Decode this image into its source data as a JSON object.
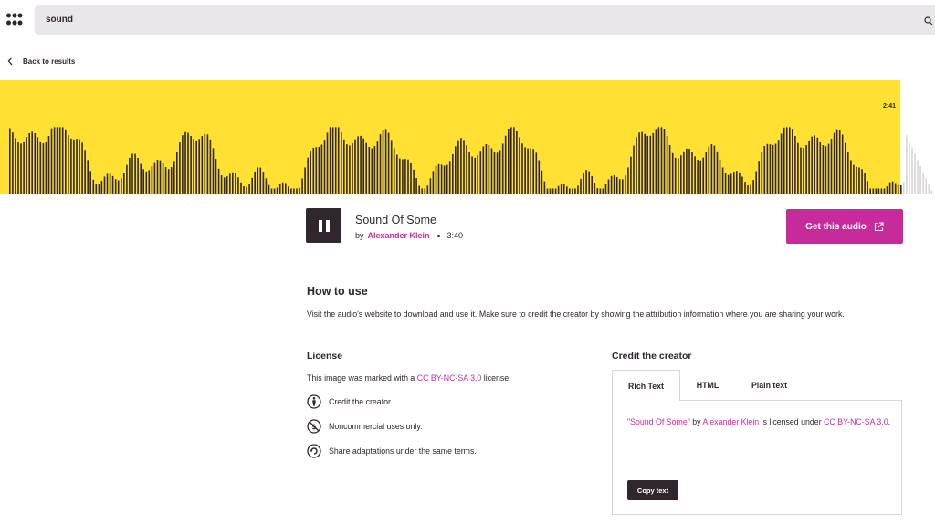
{
  "header": {
    "search_value": "sound"
  },
  "nav": {
    "back_label": "Back to results"
  },
  "player": {
    "time_marker": "2:41",
    "played_fraction": 0.963,
    "title": "Sound Of Some",
    "by": "by",
    "creator": "Alexander Klein",
    "duration": "3:40",
    "get_button": "Get this audio",
    "colors": {
      "waveform_bg": "#ffe033",
      "bar_played": "#30272e",
      "bar_unplayed": "#d8d4d8"
    }
  },
  "how_to_use": {
    "heading": "How to use",
    "text": "Visit the audio's website to download and use it. Make sure to credit the creator by showing the attribution information where you are sharing your work."
  },
  "license": {
    "heading": "License",
    "intro_before": "This image was marked with a ",
    "license_name": "CC BY-NC-SA 3.0",
    "intro_after": " license:",
    "items": [
      {
        "icon": "cc-by-icon",
        "text": "Credit the creator."
      },
      {
        "icon": "cc-nc-icon",
        "text": "Noncommercial uses only."
      },
      {
        "icon": "cc-sa-icon",
        "text": "Share adaptations under the same terms."
      }
    ]
  },
  "credit": {
    "heading": "Credit the creator",
    "tabs": [
      "Rich Text",
      "HTML",
      "Plain text"
    ],
    "active_tab": "Rich Text",
    "text_title": "\"Sound Of Some\"",
    "text_by": " by ",
    "text_creator": "Alexander Klein",
    "text_licensed": " is licensed under ",
    "text_license": "CC BY-NC-SA 3.0",
    "text_end": ".",
    "copy_button": "Copy text"
  },
  "accent_color": "#c52b9b"
}
